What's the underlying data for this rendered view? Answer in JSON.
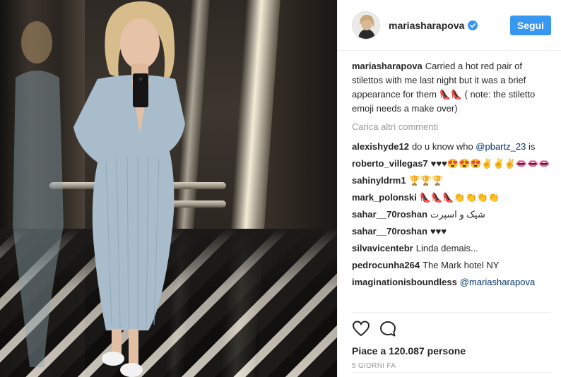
{
  "header": {
    "username": "mariasharapova",
    "follow_label": "Segui"
  },
  "caption": {
    "user": "mariasharapova",
    "text": "Carried a hot red pair of stilettos with me last night but it was a brief appearance for them 👠👠 ( note: the stiletto emoji needs a make over)"
  },
  "load_more_label": "Carica altri commenti",
  "comments": [
    {
      "user": "alexishyde12",
      "text": "do u know who ",
      "mention": "@pbartz_23",
      "text_after": " is"
    },
    {
      "user": "roberto_villegas7",
      "text": "♥♥♥😍😍😍✌✌✌👄👄👄",
      "mention": "",
      "text_after": ""
    },
    {
      "user": "sahinyldrm1",
      "text": "🏆🏆🏆",
      "mention": "",
      "text_after": ""
    },
    {
      "user": "mark_polonski",
      "text": "👠👠👠👏👏👏👏",
      "mention": "",
      "text_after": ""
    },
    {
      "user": "sahar__70roshan",
      "text": "شیک و اسپرت",
      "mention": "",
      "text_after": ""
    },
    {
      "user": "sahar__70roshan",
      "text": "♥♥♥",
      "mention": "",
      "text_after": ""
    },
    {
      "user": "silvavicentebr",
      "text": "Linda demais...",
      "mention": "",
      "text_after": ""
    },
    {
      "user": "pedrocunha264",
      "text": "The Mark hotel NY",
      "mention": "",
      "text_after": ""
    },
    {
      "user": "imaginationisboundless",
      "text": "",
      "mention": "@mariasharapova",
      "text_after": ""
    }
  ],
  "footer": {
    "likes_label": "Piace a 120.087 persone",
    "time_label": "5 GIORNI FA"
  },
  "icons": {
    "verified": "verified-badge-icon",
    "like": "heart-icon",
    "comment": "comment-bubble-icon"
  },
  "colors": {
    "follow_button": "#3897f0",
    "verified": "#3897f0",
    "mention": "#003569",
    "muted": "#999999"
  }
}
